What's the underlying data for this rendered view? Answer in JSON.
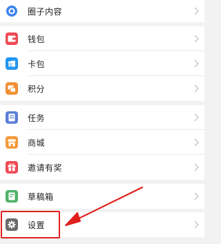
{
  "menu": {
    "g0": [
      {
        "label": "圈子内容",
        "icon": "circle-content-icon",
        "color": "#3b84ef"
      }
    ],
    "g1": [
      {
        "label": "钱包",
        "icon": "wallet-icon",
        "color": "#ef4a55"
      },
      {
        "label": "卡包",
        "icon": "card-icon",
        "color": "#2196f3"
      },
      {
        "label": "积分",
        "icon": "points-icon",
        "color": "#f19036"
      }
    ],
    "g2": [
      {
        "label": "任务",
        "icon": "task-icon",
        "color": "#5b7fd6"
      },
      {
        "label": "商城",
        "icon": "mall-icon",
        "color": "#f39a3b"
      },
      {
        "label": "邀请有奖",
        "icon": "gift-icon",
        "color": "#ef4a55"
      }
    ],
    "g3": [
      {
        "label": "草稿箱",
        "icon": "draft-icon",
        "color": "#4fb36a"
      }
    ],
    "g4": [
      {
        "label": "设置",
        "icon": "settings-gear-icon",
        "color": "#6b6b6b"
      }
    ]
  },
  "annotation": {
    "color": "#e0201c"
  }
}
